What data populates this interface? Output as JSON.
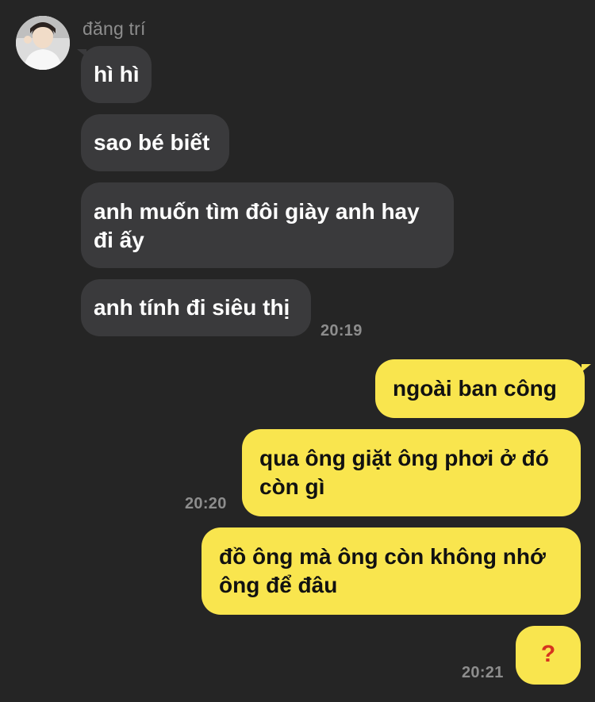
{
  "contact": {
    "name": "đăng trí"
  },
  "messages": {
    "incoming": [
      "hì hì",
      "sao bé biết",
      "anh muốn tìm đôi giày anh hay",
      "đi ấy",
      "anh tính đi siêu thị"
    ],
    "outgoing": [
      "ngoài ban công",
      "qua ông giặt ông phơi ở đó",
      "còn gì",
      "đồ ông mà ông còn không nhớ",
      "ông để đâu",
      "?"
    ]
  },
  "timestamps": {
    "t1": "20:19",
    "t2": "20:20",
    "t3": "20:21"
  },
  "colors": {
    "background": "#252525",
    "incoming_bubble": "#3a3a3c",
    "outgoing_bubble": "#f9e54e",
    "question_mark": "#d6331f"
  }
}
